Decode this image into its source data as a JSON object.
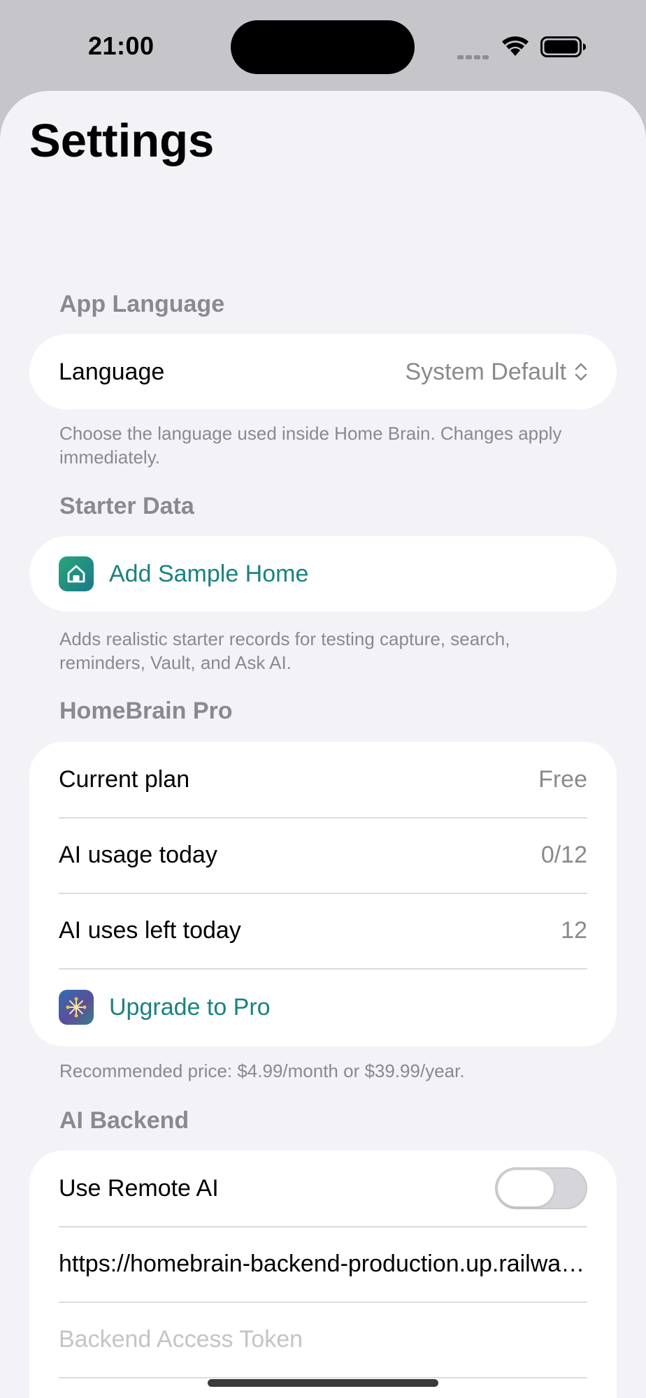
{
  "status_bar": {
    "time": "21:00"
  },
  "title": "Settings",
  "sections": {
    "app_language": {
      "header": "App Language",
      "language_label": "Language",
      "language_value": "System Default",
      "footer": "Choose the language used inside Home Brain. Changes apply immediately."
    },
    "starter_data": {
      "header": "Starter Data",
      "add_sample_label": "Add Sample Home",
      "footer": "Adds realistic starter records for testing capture, search, reminders, Vault, and Ask AI."
    },
    "pro": {
      "header": "HomeBrain Pro",
      "rows": [
        {
          "label": "Current plan",
          "value": "Free"
        },
        {
          "label": "AI usage today",
          "value": "0/12"
        },
        {
          "label": "AI uses left today",
          "value": "12"
        }
      ],
      "upgrade_label": "Upgrade to Pro",
      "footer": "Recommended price: $4.99/month or $39.99/year."
    },
    "ai_backend": {
      "header": "AI Backend",
      "remote_label": "Use Remote AI",
      "remote_enabled": false,
      "backend_url": "https://homebrain-backend-production.up.railway.app",
      "token_placeholder": "Backend Access Token"
    }
  },
  "colors": {
    "accent": "#17837f",
    "background": "#f2f2f7",
    "secondary_text": "#8a8a8e"
  },
  "icons": [
    "wifi-icon",
    "battery-icon",
    "house-icon",
    "sparkle-icon",
    "chevron-up-down-icon"
  ]
}
